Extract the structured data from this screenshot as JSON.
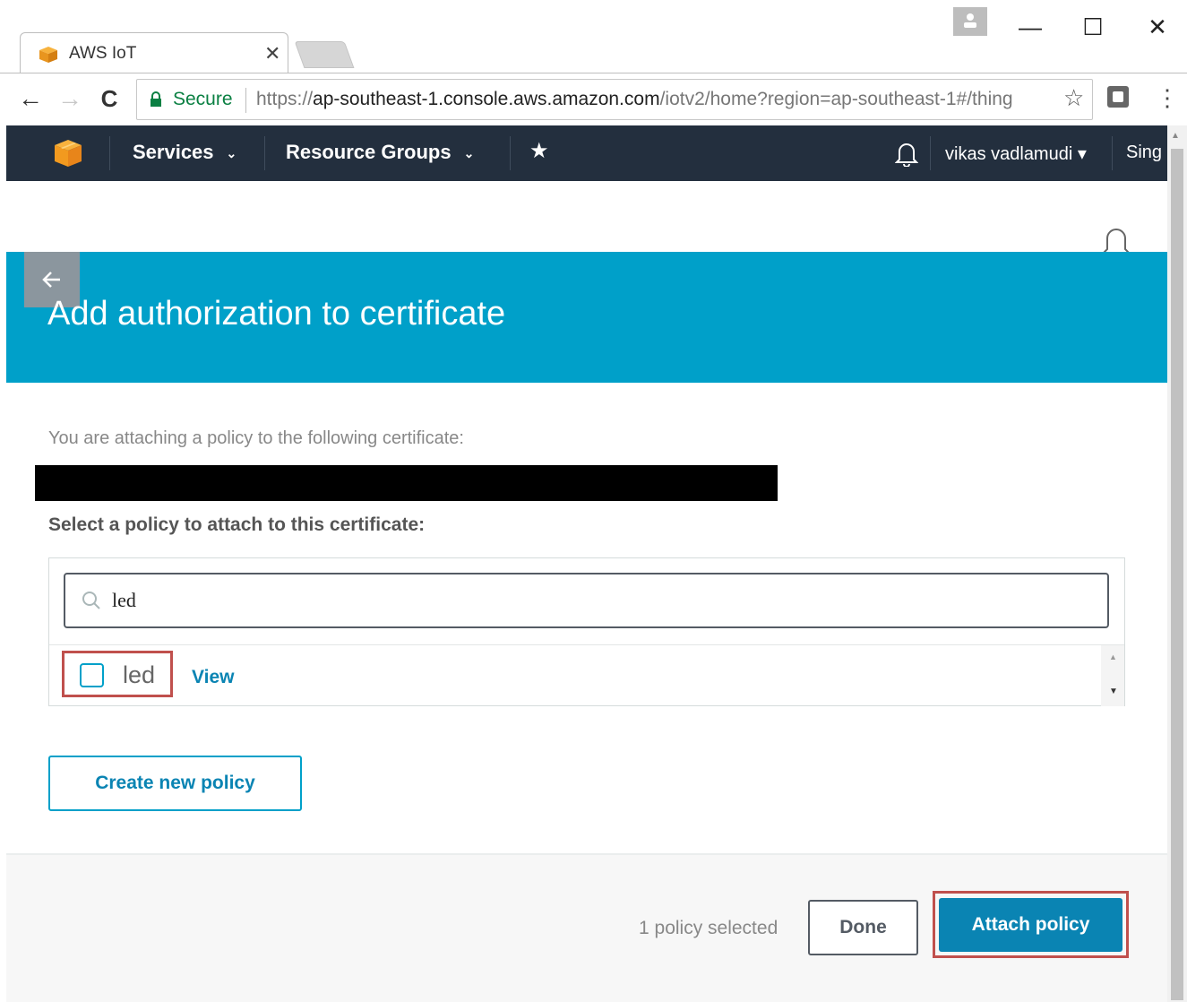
{
  "browser": {
    "tab": {
      "title": "AWS IoT",
      "close_glyph": "✕",
      "favicon": "aws-box-icon"
    },
    "window_controls": {
      "minimize": "—",
      "maximize": "☐",
      "close": "✕"
    },
    "nav": {
      "back": "←",
      "forward": "→",
      "reload": "C"
    },
    "address": {
      "secure_label": "Secure",
      "url_scheme": "https://",
      "url_host": "ap-southeast-1.console.aws.amazon.com",
      "url_path": "/iotv2/home?region=ap-southeast-1#/thing"
    },
    "star_glyph": "☆",
    "menu_glyph": "⋮"
  },
  "aws_nav": {
    "services_label": "Services",
    "resource_groups_label": "Resource Groups",
    "caret_glyph": "⌄",
    "pin_glyph": "★",
    "user_label": "vikas vadlamudi",
    "user_caret": "▾",
    "region_label": "Sing",
    "bg_color": "#232f3e"
  },
  "page": {
    "title": "Add authorization to certificate",
    "banner_color": "#00a0c9",
    "attach_text": "You are attaching a policy to the following certificate:",
    "select_label": "Select a policy to attach to this certificate:",
    "search": {
      "value": "led",
      "placeholder": ""
    },
    "policies": [
      {
        "name": "led",
        "view_label": "View",
        "checked": false
      }
    ],
    "create_policy_label": "Create new policy"
  },
  "footer": {
    "selected_count": "1 policy selected",
    "done_label": "Done",
    "attach_label": "Attach policy",
    "accent_color": "#0a84b3",
    "highlight_color": "#c0504d"
  }
}
